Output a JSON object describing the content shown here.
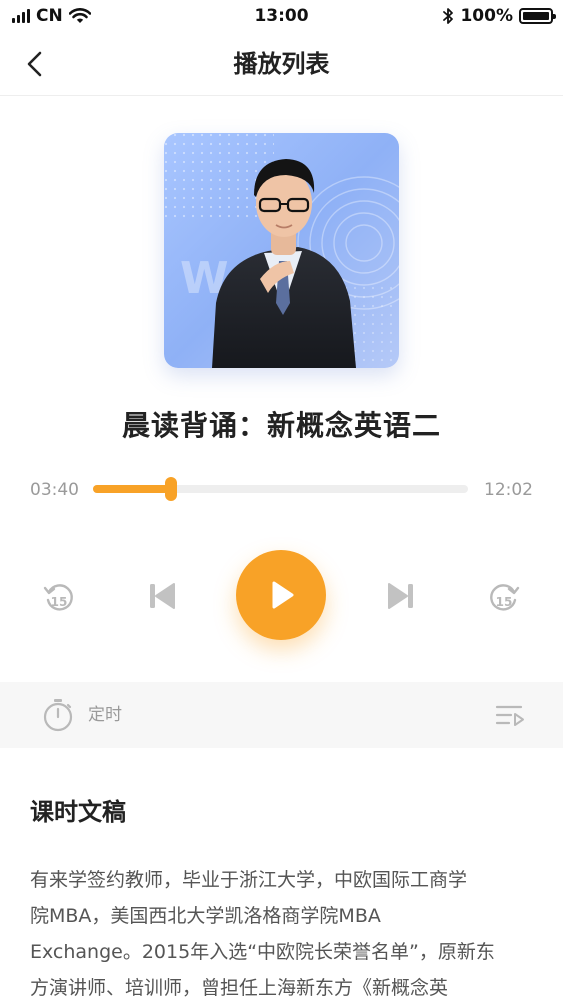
{
  "status_bar": {
    "carrier": "CN",
    "time": "13:00",
    "battery": "100%"
  },
  "nav": {
    "title": "播放列表"
  },
  "player": {
    "title": "晨读背诵：新概念英语二",
    "current_time": "03:40",
    "total_time": "12:02",
    "progress": 0.208,
    "rewind_seconds": "15",
    "forward_seconds": "15",
    "cover_watermark": "W",
    "accent_color": "#f8a227"
  },
  "toolbar": {
    "timer_label": "定时"
  },
  "transcript": {
    "heading": "课时文稿",
    "lines": [
      "有来学签约教师，毕业于浙江大学，中欧国际工商学",
      "院MBA，美国西北大学凯洛格商学院MBA",
      "Exchange。2015年入选“中欧院长荣誉名单”，原新东",
      "方演讲师、培训师，曾担任上海新东方《新概念英"
    ]
  }
}
